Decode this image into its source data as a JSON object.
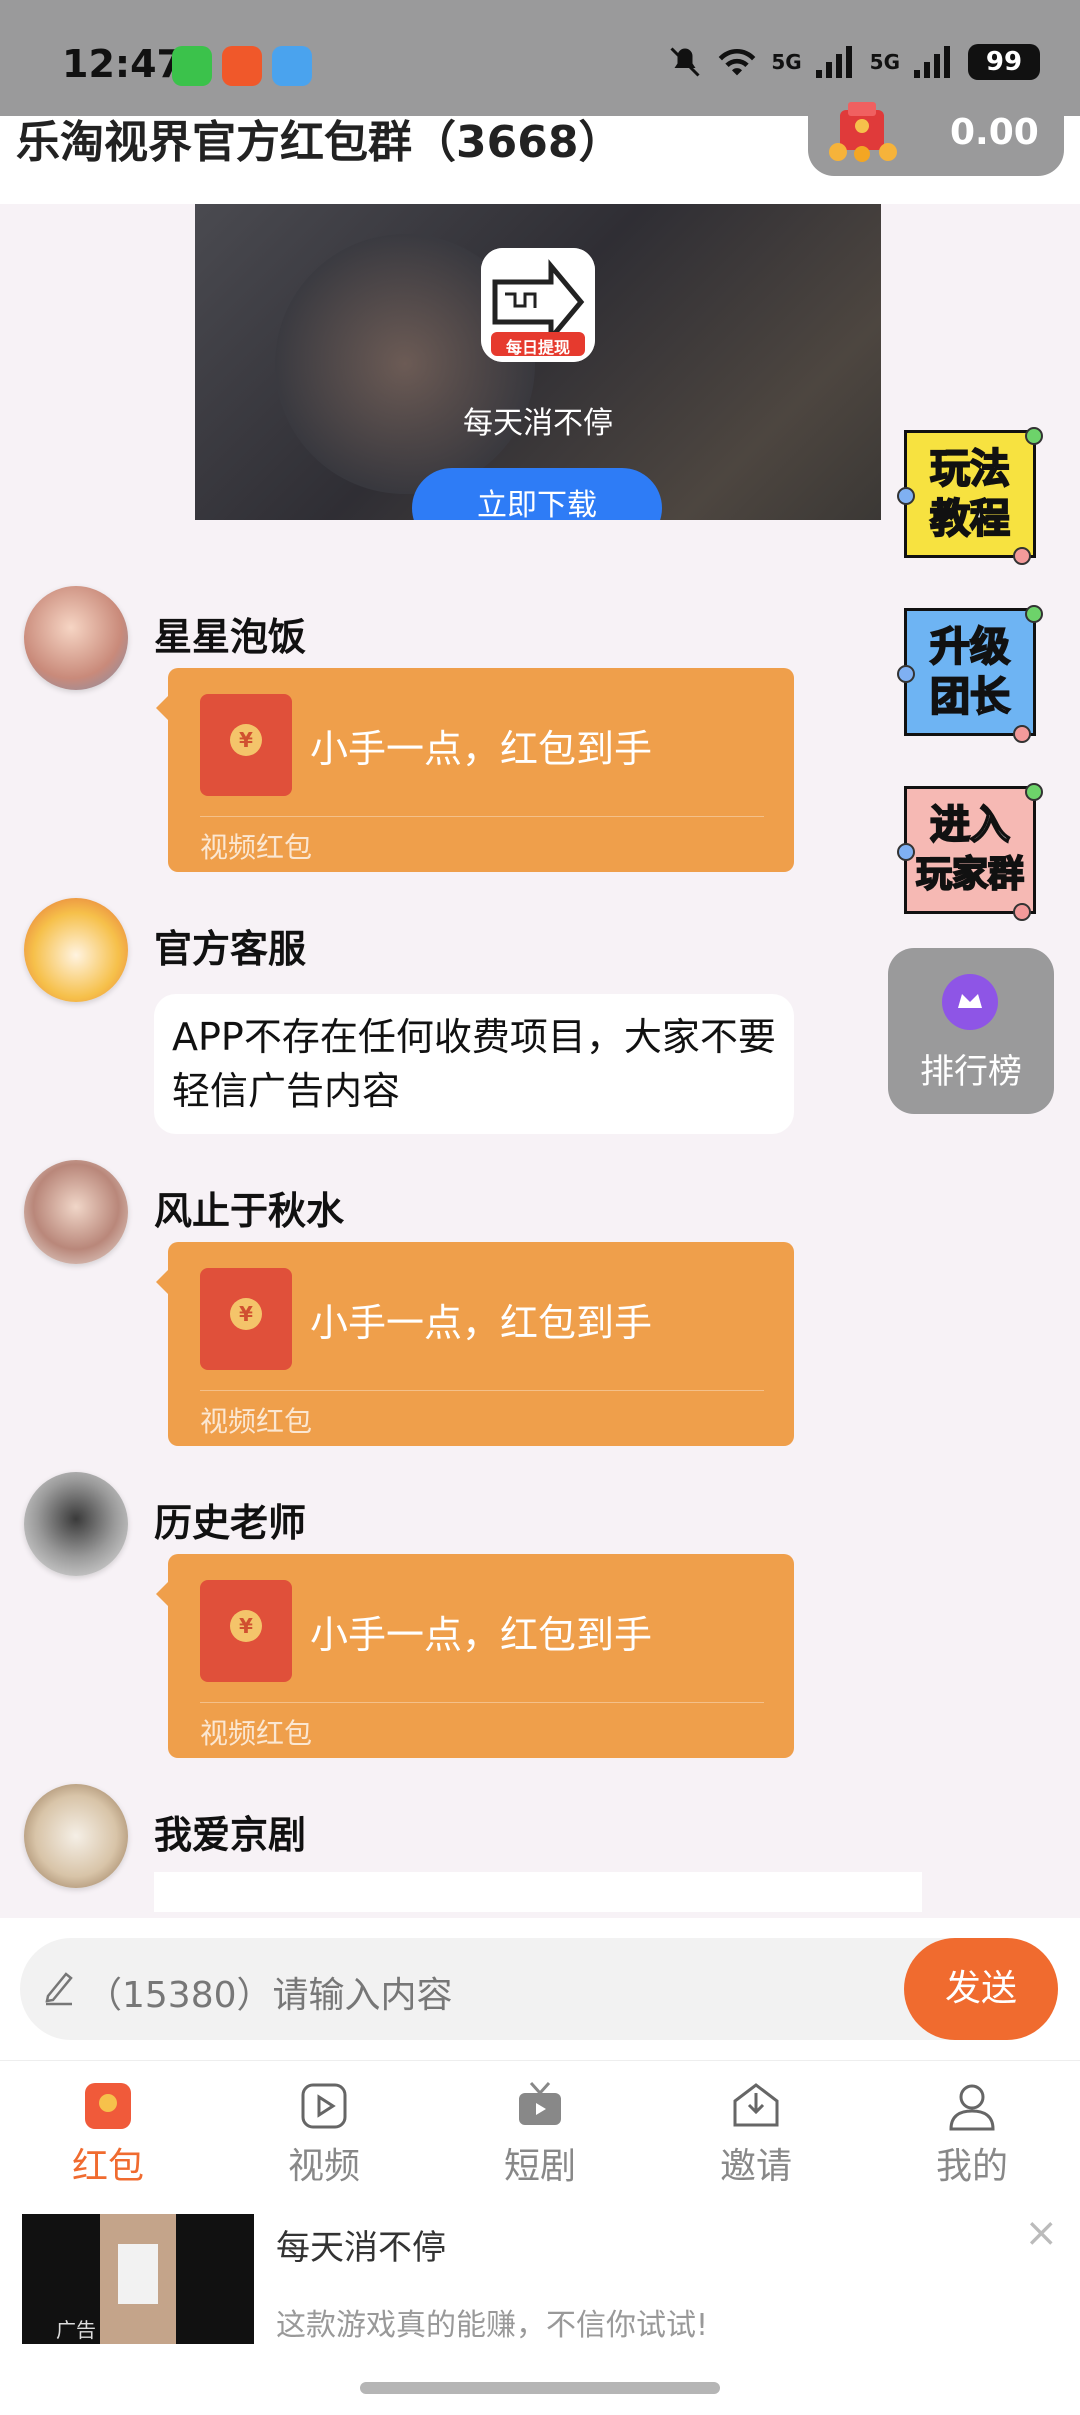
{
  "status_bar": {
    "time": "12:47",
    "net1": "5G",
    "net2": "5G",
    "battery": "99"
  },
  "header": {
    "group_title": "乐淘视界官方红包群（3668）",
    "wallet_amount": "0.00"
  },
  "top_ad": {
    "caption": "每天消不停",
    "download_label": "立即下载",
    "app_badge": "每日提现"
  },
  "messages": [
    {
      "sender": "星星泡饭",
      "type": "redpacket",
      "text": "小手一点，红包到手",
      "sub": "视频红包"
    },
    {
      "sender": "官方客服",
      "type": "text",
      "text": "APP不存在任何收费项目，大家不要轻信广告内容"
    },
    {
      "sender": "风止于秋水",
      "type": "redpacket",
      "text": "小手一点，红包到手",
      "sub": "视频红包"
    },
    {
      "sender": "历史老师",
      "type": "redpacket",
      "text": "小手一点，红包到手",
      "sub": "视频红包"
    },
    {
      "sender": "我爱京剧",
      "type": "partial"
    }
  ],
  "side_buttons": {
    "tutorial": [
      "玩法",
      "教程"
    ],
    "upgrade": [
      "升级",
      "团长"
    ],
    "join": [
      "进入",
      "玩家群"
    ],
    "ranking": "排行榜"
  },
  "input": {
    "placeholder": "（15380）请输入内容",
    "send_label": "发送"
  },
  "nav": {
    "items": [
      {
        "label": "红包",
        "icon": "redpacket-icon"
      },
      {
        "label": "视频",
        "icon": "video-icon"
      },
      {
        "label": "短剧",
        "icon": "tv-icon"
      },
      {
        "label": "邀请",
        "icon": "invite-icon"
      },
      {
        "label": "我的",
        "icon": "user-icon"
      }
    ]
  },
  "bottom_ad": {
    "title": "每天消不停",
    "desc": "这款游戏真的能赚，不信你试试!",
    "tag": "广告",
    "close": "×"
  },
  "colors": {
    "accent": "#f06b2f",
    "redpacket": "#ef9f4b",
    "overlay": "#9a9a9b"
  }
}
